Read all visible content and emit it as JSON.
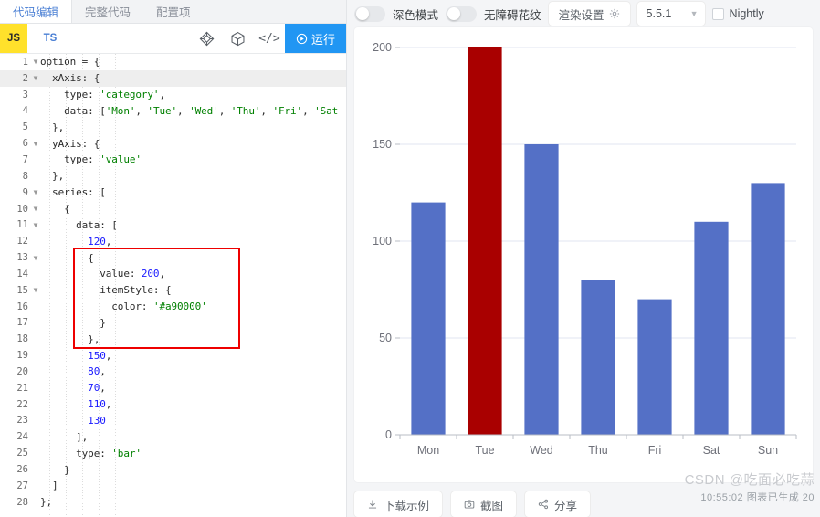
{
  "editor_panel": {
    "tabs": [
      {
        "label": "代码编辑",
        "active": true
      },
      {
        "label": "完整代码",
        "active": false
      },
      {
        "label": "配置项",
        "active": false
      }
    ],
    "toolbar": {
      "lang_js": "JS",
      "lang_ts": "TS",
      "icon_gem": "gem-icon",
      "icon_cube": "cube-icon",
      "icon_code": "</>",
      "run_label": "运行",
      "run_icon": "play-circle-icon"
    },
    "highlight_box_color": "#ee0000",
    "code_lines": [
      {
        "n": 1,
        "fold": true,
        "indent": 0,
        "tokens": [
          [
            "pln",
            "option = {"
          ]
        ]
      },
      {
        "n": 2,
        "fold": true,
        "indent": 1,
        "highlight": true,
        "tokens": [
          [
            "pln",
            "  xAxis: {"
          ]
        ]
      },
      {
        "n": 3,
        "fold": false,
        "indent": 2,
        "tokens": [
          [
            "pln",
            "    type: "
          ],
          [
            "str",
            "'category'"
          ],
          [
            "pln",
            ","
          ]
        ]
      },
      {
        "n": 4,
        "fold": false,
        "indent": 2,
        "tokens": [
          [
            "pln",
            "    data: ["
          ],
          [
            "str",
            "'Mon'"
          ],
          [
            "pln",
            ", "
          ],
          [
            "str",
            "'Tue'"
          ],
          [
            "pln",
            ", "
          ],
          [
            "str",
            "'Wed'"
          ],
          [
            "pln",
            ", "
          ],
          [
            "str",
            "'Thu'"
          ],
          [
            "pln",
            ", "
          ],
          [
            "str",
            "'Fri'"
          ],
          [
            "pln",
            ", "
          ],
          [
            "str",
            "'Sat"
          ]
        ]
      },
      {
        "n": 5,
        "fold": false,
        "indent": 1,
        "tokens": [
          [
            "pln",
            "  },"
          ]
        ]
      },
      {
        "n": 6,
        "fold": true,
        "indent": 1,
        "tokens": [
          [
            "pln",
            "  yAxis: {"
          ]
        ]
      },
      {
        "n": 7,
        "fold": false,
        "indent": 2,
        "tokens": [
          [
            "pln",
            "    type: "
          ],
          [
            "str",
            "'value'"
          ]
        ]
      },
      {
        "n": 8,
        "fold": false,
        "indent": 1,
        "tokens": [
          [
            "pln",
            "  },"
          ]
        ]
      },
      {
        "n": 9,
        "fold": true,
        "indent": 1,
        "tokens": [
          [
            "pln",
            "  series: ["
          ]
        ]
      },
      {
        "n": 10,
        "fold": true,
        "indent": 2,
        "tokens": [
          [
            "pln",
            "    {"
          ]
        ]
      },
      {
        "n": 11,
        "fold": true,
        "indent": 3,
        "tokens": [
          [
            "pln",
            "      data: ["
          ]
        ]
      },
      {
        "n": 12,
        "fold": false,
        "indent": 4,
        "tokens": [
          [
            "num",
            "        120"
          ],
          [
            "pln",
            ","
          ]
        ]
      },
      {
        "n": 13,
        "fold": true,
        "indent": 4,
        "tokens": [
          [
            "pln",
            "        {"
          ]
        ]
      },
      {
        "n": 14,
        "fold": false,
        "indent": 5,
        "tokens": [
          [
            "pln",
            "          value: "
          ],
          [
            "num",
            "200"
          ],
          [
            "pln",
            ","
          ]
        ]
      },
      {
        "n": 15,
        "fold": true,
        "indent": 5,
        "tokens": [
          [
            "pln",
            "          itemStyle: {"
          ]
        ]
      },
      {
        "n": 16,
        "fold": false,
        "indent": 6,
        "tokens": [
          [
            "pln",
            "            color: "
          ],
          [
            "str",
            "'#a90000'"
          ]
        ]
      },
      {
        "n": 17,
        "fold": false,
        "indent": 5,
        "tokens": [
          [
            "pln",
            "          }"
          ]
        ]
      },
      {
        "n": 18,
        "fold": false,
        "indent": 4,
        "tokens": [
          [
            "pln",
            "        },"
          ]
        ]
      },
      {
        "n": 19,
        "fold": false,
        "indent": 4,
        "tokens": [
          [
            "num",
            "        150"
          ],
          [
            "pln",
            ","
          ]
        ]
      },
      {
        "n": 20,
        "fold": false,
        "indent": 4,
        "tokens": [
          [
            "num",
            "        80"
          ],
          [
            "pln",
            ","
          ]
        ]
      },
      {
        "n": 21,
        "fold": false,
        "indent": 4,
        "tokens": [
          [
            "num",
            "        70"
          ],
          [
            "pln",
            ","
          ]
        ]
      },
      {
        "n": 22,
        "fold": false,
        "indent": 4,
        "tokens": [
          [
            "num",
            "        110"
          ],
          [
            "pln",
            ","
          ]
        ]
      },
      {
        "n": 23,
        "fold": false,
        "indent": 4,
        "tokens": [
          [
            "num",
            "        130"
          ]
        ]
      },
      {
        "n": 24,
        "fold": false,
        "indent": 3,
        "tokens": [
          [
            "pln",
            "      ],"
          ]
        ]
      },
      {
        "n": 25,
        "fold": false,
        "indent": 3,
        "tokens": [
          [
            "pln",
            "      type: "
          ],
          [
            "str",
            "'bar'"
          ]
        ]
      },
      {
        "n": 26,
        "fold": false,
        "indent": 2,
        "tokens": [
          [
            "pln",
            "    }"
          ]
        ]
      },
      {
        "n": 27,
        "fold": false,
        "indent": 1,
        "tokens": [
          [
            "pln",
            "  ]"
          ]
        ]
      },
      {
        "n": 28,
        "fold": false,
        "indent": 0,
        "tokens": [
          [
            "pln",
            "};"
          ]
        ]
      }
    ]
  },
  "preview_panel": {
    "header": {
      "dark_mode_label": "深色模式",
      "dark_mode_on": false,
      "accessible_pattern_label": "无障碍花纹",
      "accessible_pattern_on": false,
      "render_settings_label": "渲染设置",
      "render_settings_icon": "gear-icon",
      "version": "5.5.1",
      "version_chevron": "chevron-down-icon",
      "nightly_label": "Nightly",
      "nightly_checked": false
    },
    "footer": {
      "buttons": [
        {
          "label": "下载示例",
          "icon": "download-icon"
        },
        {
          "label": "截图",
          "icon": "camera-icon"
        },
        {
          "label": "分享",
          "icon": "share-icon"
        }
      ]
    },
    "watermark": {
      "line1": "CSDN @吃面必吃蒜",
      "line2": "10:55:02  图表已生成  20"
    }
  },
  "chart_data": {
    "type": "bar",
    "title": "",
    "xlabel": "",
    "ylabel": "",
    "categories": [
      "Mon",
      "Tue",
      "Wed",
      "Thu",
      "Fri",
      "Sat",
      "Sun"
    ],
    "values": [
      120,
      200,
      150,
      80,
      70,
      110,
      130
    ],
    "bar_colors": [
      "#5470c6",
      "#a90000",
      "#5470c6",
      "#5470c6",
      "#5470c6",
      "#5470c6",
      "#5470c6"
    ],
    "default_color": "#5470c6",
    "ylim": [
      0,
      200
    ],
    "yticks": [
      0,
      50,
      100,
      150,
      200
    ],
    "ytick_labels": [
      "0",
      "50",
      "100",
      "150",
      "200"
    ],
    "grid": true,
    "grid_color": "#e0e6f1",
    "axis_line_color": "#b8bdc4",
    "tick_label_color": "#6e7079",
    "legend": null,
    "legend_position": "none"
  }
}
